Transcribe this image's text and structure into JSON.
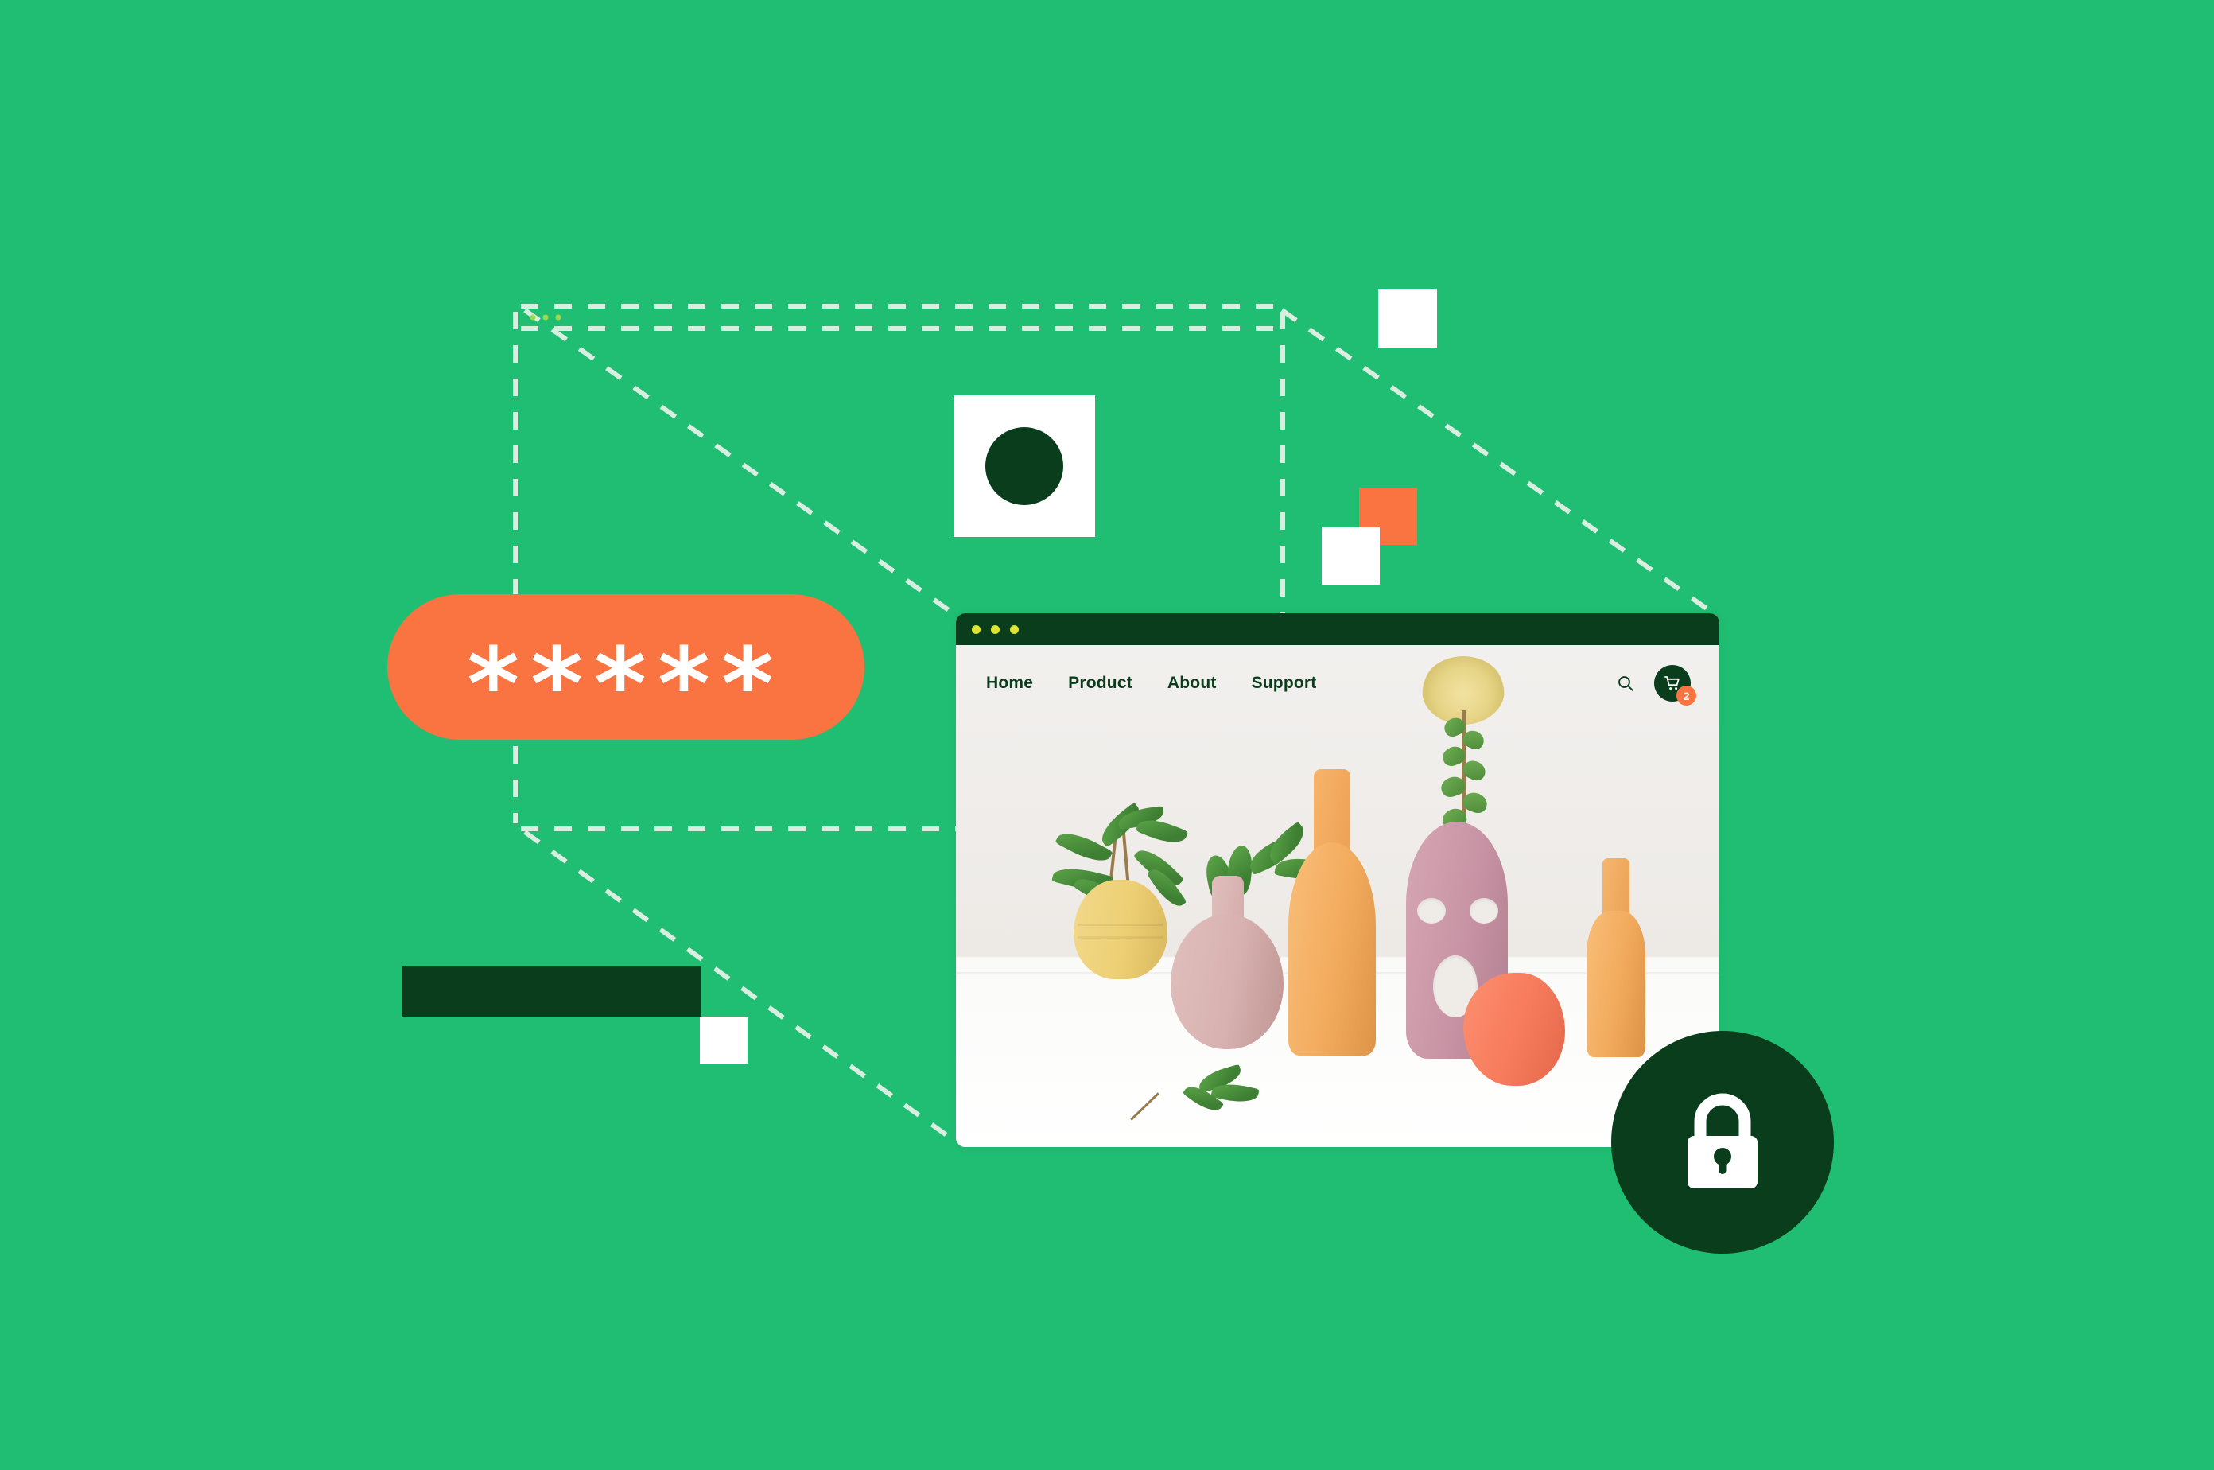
{
  "theme": {
    "background": "#1FBE72",
    "accent_orange": "#F97440",
    "dark_green": "#0A3D1C",
    "white": "#FFFFFF",
    "traffic_dot": "#DCE334"
  },
  "password_field": {
    "name": "password-field",
    "masked_value": "*****",
    "character_count": 5,
    "background": "#F97440"
  },
  "browser": {
    "titlebar": {
      "traffic_lights": [
        "dot-1",
        "dot-2",
        "dot-3"
      ],
      "color": "#0A3D1C"
    },
    "site": {
      "nav_links": [
        {
          "label": "Home"
        },
        {
          "label": "Product"
        },
        {
          "label": "About"
        },
        {
          "label": "Support"
        }
      ],
      "actions": {
        "search_icon": "search-icon",
        "cart_icon": "shopping-cart-icon",
        "cart_badge_count": "2"
      },
      "hero": {
        "alt": "Still life photograph of pastel ceramic vases with green foliage"
      }
    }
  },
  "decorations": {
    "ghost_window_outline": "dashed-browser-outline",
    "squares": [
      {
        "name": "square-circle-badge",
        "fill": "#FFFFFF",
        "inner": "circle",
        "inner_fill": "#0A3D1C"
      },
      {
        "name": "square-top-right",
        "fill": "#FFFFFF"
      },
      {
        "name": "square-orange-mid",
        "fill": "#F97440"
      },
      {
        "name": "square-white-mid",
        "fill": "#FFFFFF"
      },
      {
        "name": "bar-dark",
        "fill": "#0A3D1C"
      },
      {
        "name": "square-white-bottom",
        "fill": "#FFFFFF"
      }
    ]
  },
  "lock_badge": {
    "name": "lock-badge",
    "icon": "padlock-closed-icon",
    "circle_fill": "#0A3D1C",
    "icon_fill": "#FFFFFF"
  }
}
